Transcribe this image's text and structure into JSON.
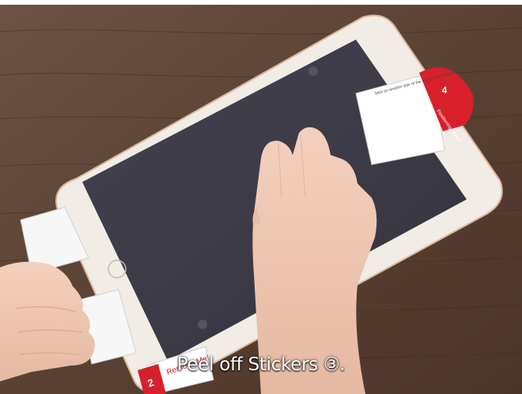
{
  "caption": "Peel off Stickers ③.",
  "positioning_sticker": {
    "number": "4",
    "label": "Positioning Sticker",
    "instruction": "Stick on another side of the screen protector to align and fix the film to the screen."
  },
  "remove_sticker": {
    "number": "2",
    "label": "Remove Me!"
  },
  "colors": {
    "wood": "#5a4233",
    "tablet_body": "#f1ece6",
    "screen": "#3d3b49",
    "sticker_red": "#d7202a",
    "skin": "#efc9b4",
    "caption_text": "#ffffff"
  }
}
